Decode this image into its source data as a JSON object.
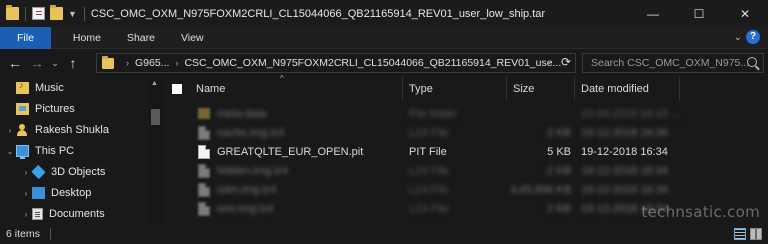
{
  "window": {
    "title": "CSC_OMC_OXM_N975FOXM2CRLI_CL15044066_QB21165914_REV01_user_low_ship.tar",
    "minimize": "—",
    "maximize": "☐",
    "close": "✕"
  },
  "ribbon": {
    "tabs": [
      "File",
      "Home",
      "Share",
      "View"
    ],
    "expand": "⌄",
    "help": "?"
  },
  "address": {
    "back": "←",
    "forward": "→",
    "recent": "⌄",
    "up": "↑",
    "crumbs": [
      "G965...",
      "CSC_OMC_OXM_N975FOXM2CRLI_CL15044066_QB21165914_REV01_use..."
    ],
    "crumb_separator": "›",
    "dropdown": "⌄",
    "refresh": "⟳",
    "search_placeholder": "Search CSC_OMC_OXM_N975..."
  },
  "nav": {
    "items": [
      {
        "label": "Music",
        "icon": "music-icon"
      },
      {
        "label": "Pictures",
        "icon": "pictures-icon"
      },
      {
        "label": "Rakesh Shukla",
        "icon": "user-icon"
      },
      {
        "label": "This PC",
        "icon": "pc-icon"
      },
      {
        "label": "3D Objects",
        "icon": "3d-objects-icon"
      },
      {
        "label": "Desktop",
        "icon": "desktop-icon"
      },
      {
        "label": "Documents",
        "icon": "documents-icon"
      }
    ],
    "expander": "›"
  },
  "columns": {
    "name": "Name",
    "type": "Type",
    "size": "Size",
    "date": "Date modified",
    "sort_indicator": "^"
  },
  "files": [
    {
      "name": "meta-data",
      "type": "File folder",
      "size": "",
      "date": "20-04-2020 04:15 ...",
      "blurred": true,
      "kind": "folder"
    },
    {
      "name": "cache.img.lz4",
      "type": "LZ4 File",
      "size": "2 KB",
      "date": "19-12-2018 16:34",
      "blurred": true,
      "kind": "file"
    },
    {
      "name": "GREATQLTE_EUR_OPEN.pit",
      "type": "PIT File",
      "size": "5 KB",
      "date": "19-12-2018 16:34",
      "blurred": false,
      "kind": "file"
    },
    {
      "name": "hidden.img.lz4",
      "type": "LZ4 File",
      "size": "2 KB",
      "date": "19-12-2018 16:34",
      "blurred": true,
      "kind": "file"
    },
    {
      "name": "odm.img.lz4",
      "type": "LZ4 File",
      "size": "4,65,896 KB",
      "date": "19-12-2018 16:34",
      "blurred": true,
      "kind": "file"
    },
    {
      "name": "omr.img.lz4",
      "type": "LZ4 File",
      "size": "2 KB",
      "date": "19-12-2018 16:34",
      "blurred": true,
      "kind": "file"
    }
  ],
  "status": {
    "count": "6 items"
  },
  "watermark": "technsatic.com"
}
